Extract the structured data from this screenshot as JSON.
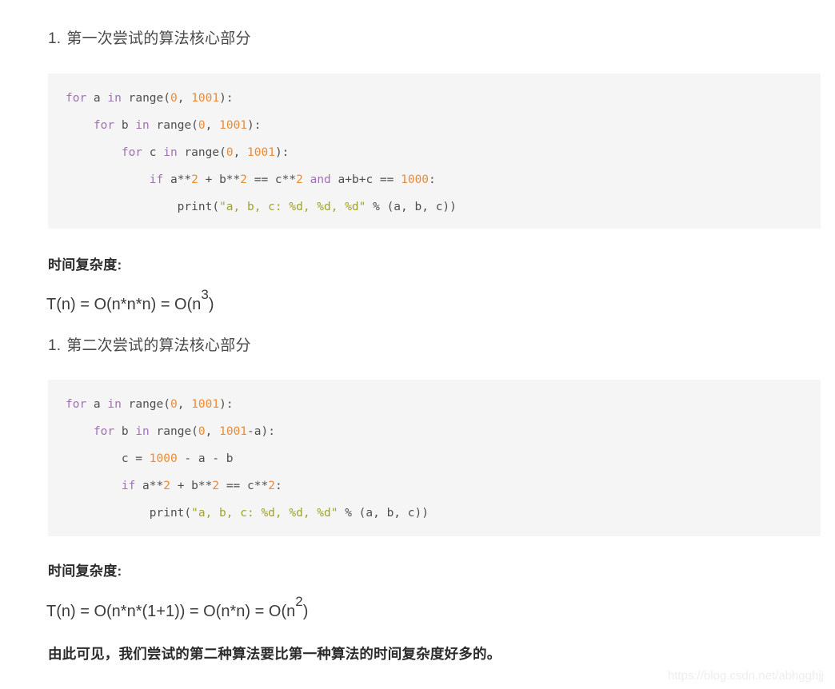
{
  "document": {
    "section_one": {
      "heading_marker": "1.",
      "heading_text": "第一次尝试的算法核心部分",
      "code_lines": [
        [
          {
            "t": "for",
            "c": "kw"
          },
          {
            "t": " a ",
            "c": "plain"
          },
          {
            "t": "in",
            "c": "kw"
          },
          {
            "t": " range(",
            "c": "plain"
          },
          {
            "t": "0",
            "c": "num"
          },
          {
            "t": ", ",
            "c": "plain"
          },
          {
            "t": "1001",
            "c": "num"
          },
          {
            "t": "):",
            "c": "plain"
          }
        ],
        [
          {
            "t": "    ",
            "c": "plain"
          },
          {
            "t": "for",
            "c": "kw"
          },
          {
            "t": " b ",
            "c": "plain"
          },
          {
            "t": "in",
            "c": "kw"
          },
          {
            "t": " range(",
            "c": "plain"
          },
          {
            "t": "0",
            "c": "num"
          },
          {
            "t": ", ",
            "c": "plain"
          },
          {
            "t": "1001",
            "c": "num"
          },
          {
            "t": "):",
            "c": "plain"
          }
        ],
        [
          {
            "t": "        ",
            "c": "plain"
          },
          {
            "t": "for",
            "c": "kw"
          },
          {
            "t": " c ",
            "c": "plain"
          },
          {
            "t": "in",
            "c": "kw"
          },
          {
            "t": " range(",
            "c": "plain"
          },
          {
            "t": "0",
            "c": "num"
          },
          {
            "t": ", ",
            "c": "plain"
          },
          {
            "t": "1001",
            "c": "num"
          },
          {
            "t": "):",
            "c": "plain"
          }
        ],
        [
          {
            "t": "            ",
            "c": "plain"
          },
          {
            "t": "if",
            "c": "kw"
          },
          {
            "t": " a**",
            "c": "plain"
          },
          {
            "t": "2",
            "c": "num"
          },
          {
            "t": " + b**",
            "c": "plain"
          },
          {
            "t": "2",
            "c": "num"
          },
          {
            "t": " == c**",
            "c": "plain"
          },
          {
            "t": "2",
            "c": "num"
          },
          {
            "t": " ",
            "c": "plain"
          },
          {
            "t": "and",
            "c": "kw"
          },
          {
            "t": " a+b+c == ",
            "c": "plain"
          },
          {
            "t": "1000",
            "c": "num"
          },
          {
            "t": ":",
            "c": "plain"
          }
        ],
        [
          {
            "t": "                print(",
            "c": "plain"
          },
          {
            "t": "\"a, b, c: %d, %d, %d\"",
            "c": "str"
          },
          {
            "t": " % (a, b, c))",
            "c": "plain"
          }
        ]
      ],
      "complexity_label": "时间复杂度:",
      "complexity_formula_base": "T(n) = O(n*n*n) = O(n",
      "complexity_formula_exp": "3",
      "complexity_formula_tail": ")"
    },
    "section_two": {
      "heading_marker": "1.",
      "heading_text": "第二次尝试的算法核心部分",
      "code_lines": [
        [
          {
            "t": "for",
            "c": "kw"
          },
          {
            "t": " a ",
            "c": "plain"
          },
          {
            "t": "in",
            "c": "kw"
          },
          {
            "t": " range(",
            "c": "plain"
          },
          {
            "t": "0",
            "c": "num"
          },
          {
            "t": ", ",
            "c": "plain"
          },
          {
            "t": "1001",
            "c": "num"
          },
          {
            "t": "):",
            "c": "plain"
          }
        ],
        [
          {
            "t": "    ",
            "c": "plain"
          },
          {
            "t": "for",
            "c": "kw"
          },
          {
            "t": " b ",
            "c": "plain"
          },
          {
            "t": "in",
            "c": "kw"
          },
          {
            "t": " range(",
            "c": "plain"
          },
          {
            "t": "0",
            "c": "num"
          },
          {
            "t": ", ",
            "c": "plain"
          },
          {
            "t": "1001",
            "c": "num"
          },
          {
            "t": "-a):",
            "c": "plain"
          }
        ],
        [
          {
            "t": "        c = ",
            "c": "plain"
          },
          {
            "t": "1000",
            "c": "num"
          },
          {
            "t": " - a - b",
            "c": "plain"
          }
        ],
        [
          {
            "t": "        ",
            "c": "plain"
          },
          {
            "t": "if",
            "c": "kw"
          },
          {
            "t": " a**",
            "c": "plain"
          },
          {
            "t": "2",
            "c": "num"
          },
          {
            "t": " + b**",
            "c": "plain"
          },
          {
            "t": "2",
            "c": "num"
          },
          {
            "t": " == c**",
            "c": "plain"
          },
          {
            "t": "2",
            "c": "num"
          },
          {
            "t": ":",
            "c": "plain"
          }
        ],
        [
          {
            "t": "            print(",
            "c": "plain"
          },
          {
            "t": "\"a, b, c: %d, %d, %d\"",
            "c": "str"
          },
          {
            "t": " % (a, b, c))",
            "c": "plain"
          }
        ]
      ],
      "complexity_label": "时间复杂度:",
      "complexity_formula_base": "T(n) = O(n*n*(1+1)) = O(n*n) = O(n",
      "complexity_formula_exp": "2",
      "complexity_formula_tail": ")"
    },
    "conclusion": "由此可见，我们尝试的第二种算法要比第一种算法的时间复杂度好多的。",
    "watermark": "https://blog.csdn.net/abhgghjj"
  },
  "colors": {
    "keyword": "#a071b5",
    "number": "#ec8b36",
    "string": "#a0a32a",
    "code_text": "#4f4f4f",
    "code_background": "#f5f5f5",
    "body_text": "#3b3b3b",
    "watermark": "#eceef0"
  }
}
